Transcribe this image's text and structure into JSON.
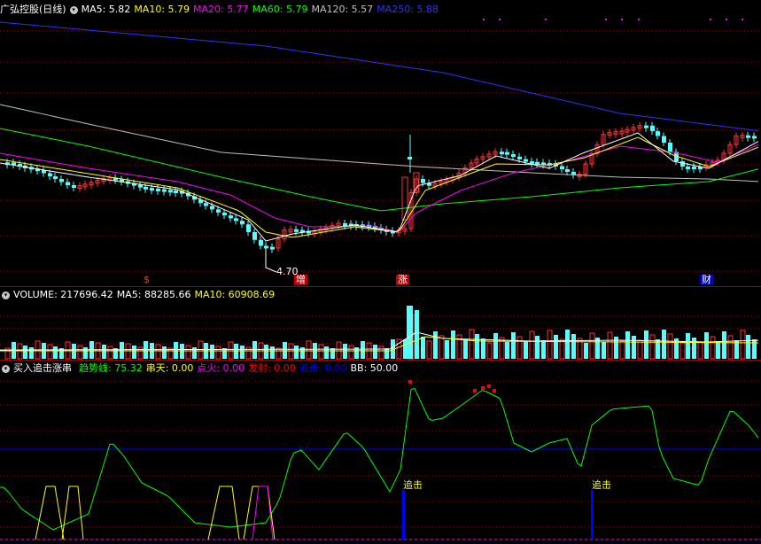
{
  "price_panel": {
    "title": "广弘控股(日线)",
    "toggle_icon": "chevron-down-icon",
    "indicators": [
      {
        "label": "MA5: 5.82",
        "color": "#ffffff"
      },
      {
        "label": "MA10: 5.79",
        "color": "#ffff00"
      },
      {
        "label": "MA20: 5.77",
        "color": "#ff00ff"
      },
      {
        "label": "MA60: 5.79",
        "color": "#00ff00"
      },
      {
        "label": "MA120: 5.57",
        "color": "#c0c0c0"
      },
      {
        "label": "MA250: 5.88",
        "color": "#0000ff"
      }
    ],
    "low_label": "4.70",
    "markers": [
      {
        "text": "$",
        "color": "#ff3030"
      },
      {
        "text": "增",
        "color": "#ffffff",
        "bg": "#c00000"
      },
      {
        "text": "涨",
        "color": "#ffffff",
        "bg": "#c00000"
      },
      {
        "text": "财",
        "color": "#ffffff",
        "bg": "#0000c0"
      }
    ]
  },
  "volume_panel": {
    "toggle_icon": "chevron-down-icon",
    "indicators": [
      {
        "label": "VOLUME: 217696.42",
        "color": "#ffffff"
      },
      {
        "label": "MA5: 88285.66",
        "color": "#ffffff"
      },
      {
        "label": "MA10: 60908.69",
        "color": "#ffff00"
      }
    ]
  },
  "indicator_panel": {
    "toggle_icon": "chevron-down-icon",
    "name": "买入追击涨串",
    "indicators": [
      {
        "label": "趋势线: 75.32",
        "color": "#00ff00"
      },
      {
        "label": "串天: 0.00",
        "color": "#ffff00"
      },
      {
        "label": "点火: 0.00",
        "color": "#ff00ff"
      },
      {
        "label": "发射: 0.00",
        "color": "#ff0000"
      },
      {
        "label": "追击: 0.00",
        "color": "#0000ff"
      },
      {
        "label": "BB: 50.00",
        "color": "#ffffff"
      }
    ],
    "signal_labels": [
      "追击",
      "追击"
    ]
  },
  "colors": {
    "up": "#ff3232",
    "down": "#54ffff",
    "ma5": "#ffffff",
    "ma10": "#ffff00",
    "ma20": "#ff00ff",
    "ma60": "#00ff00",
    "ma120": "#c0c0c0",
    "ma250": "#3030ff",
    "grid": "#a00000"
  }
}
